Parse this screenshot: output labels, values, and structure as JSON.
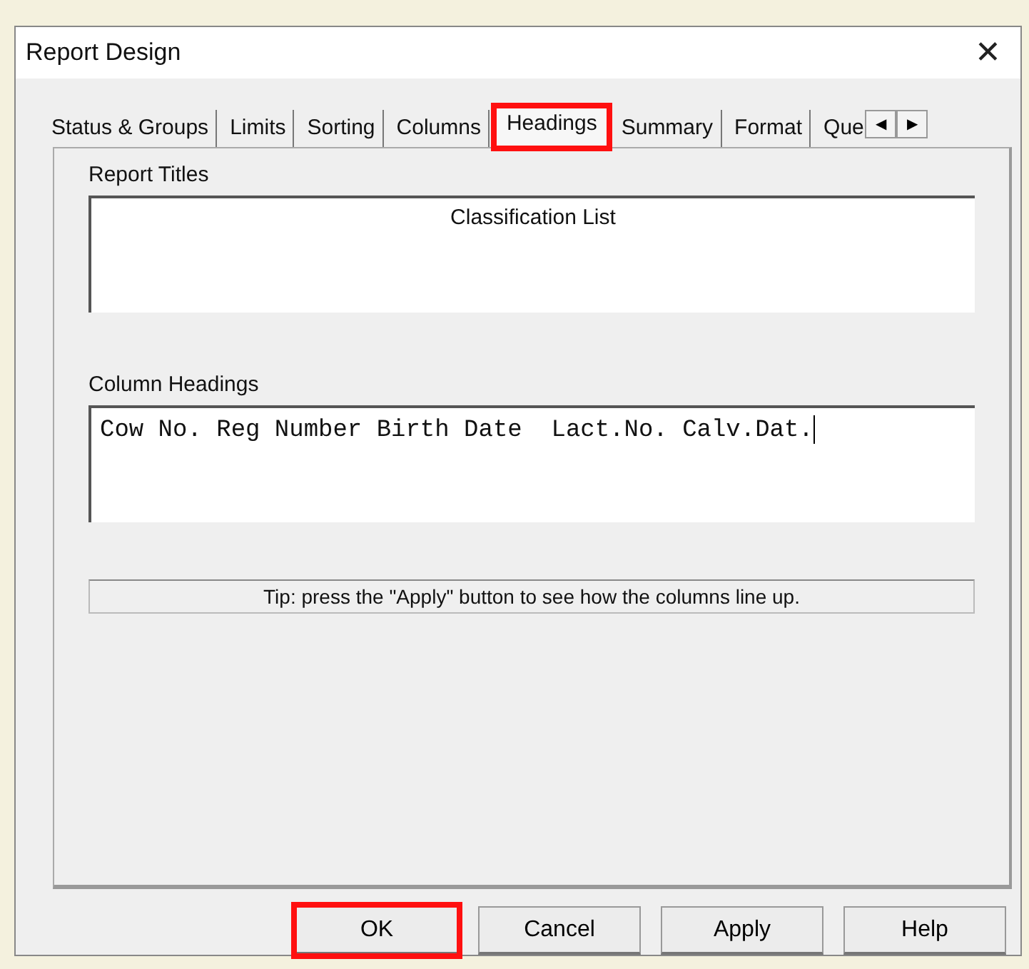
{
  "window": {
    "title": "Report Design",
    "close": "✕"
  },
  "tabs": [
    {
      "label": "Status & Groups",
      "selected": false,
      "highlighted": false
    },
    {
      "label": "Limits",
      "selected": false,
      "highlighted": false
    },
    {
      "label": "Sorting",
      "selected": false,
      "highlighted": false
    },
    {
      "label": "Columns",
      "selected": false,
      "highlighted": false
    },
    {
      "label": "Headings",
      "selected": true,
      "highlighted": true
    },
    {
      "label": "Summary",
      "selected": false,
      "highlighted": false
    },
    {
      "label": "Format",
      "selected": false,
      "highlighted": false
    },
    {
      "label": "Que",
      "selected": false,
      "highlighted": false
    }
  ],
  "tab_scroll": [
    "◀",
    "▶"
  ],
  "report_titles": {
    "label": "Report Titles",
    "value": "Classification List"
  },
  "column_headings": {
    "label": "Column Headings",
    "value": "Cow No. Reg Number Birth Date  Lact.No. Calv.Dat."
  },
  "tip": "Tip: press the \"Apply\" button to see how the columns line up.",
  "buttons": [
    {
      "label": "OK",
      "highlighted": true
    },
    {
      "label": "Cancel",
      "highlighted": false
    },
    {
      "label": "Apply",
      "highlighted": false
    },
    {
      "label": "Help",
      "highlighted": false
    }
  ]
}
